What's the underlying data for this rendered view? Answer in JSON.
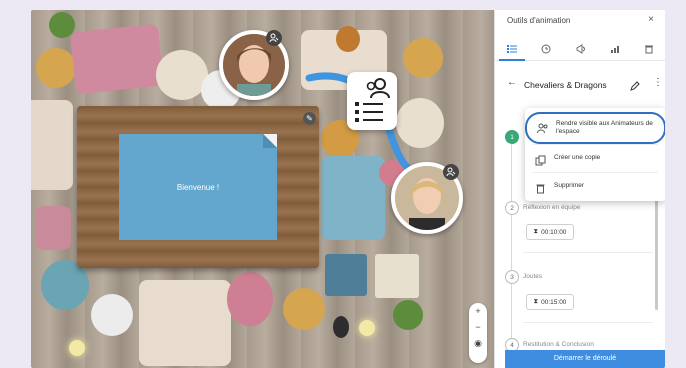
{
  "screen": {
    "welcome": "Bienvenue !"
  },
  "panel": {
    "title": "Outils d'animation",
    "close": "×",
    "tabs": [
      "list-icon",
      "clock-icon",
      "megaphone-icon",
      "chart-icon",
      "trash-icon"
    ],
    "back": "←",
    "activity_name": "Chevaliers & Dragons",
    "more": "⋮",
    "steps": [
      {
        "num": "1",
        "label": "",
        "duration": ""
      },
      {
        "num": "2",
        "label": "Réflexion en équipe",
        "duration": "00:10:00"
      },
      {
        "num": "3",
        "label": "Joutes",
        "duration": "00:15:00"
      },
      {
        "num": "4",
        "label": "Restitution & Conclusion",
        "duration": ""
      }
    ],
    "start_button": "Démarrer le déroulé"
  },
  "menu": {
    "items": [
      {
        "label": "Rendre visible aux Animateurs de l'espace",
        "icon": "people-icon"
      },
      {
        "label": "Créer une copie",
        "icon": "copy-icon"
      },
      {
        "label": "Supprimer",
        "icon": "trash-icon"
      }
    ]
  },
  "zoom": {
    "plus": "+",
    "minus": "−"
  },
  "colors": {
    "accent": "#3e8de0",
    "done": "#3aa776",
    "screen": "#63a7cf"
  }
}
